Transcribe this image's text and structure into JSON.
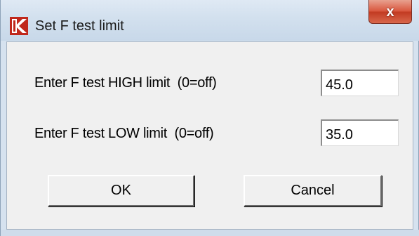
{
  "window": {
    "title": "Set F test limit",
    "close_label": "x",
    "icon": "app-logo-icon"
  },
  "form": {
    "high_label": "Enter F test HIGH limit  (0=off)",
    "high_value": "45.0",
    "low_label": "Enter F test LOW limit  (0=off)",
    "low_value": "35.0"
  },
  "buttons": {
    "ok_label": "OK",
    "cancel_label": "Cancel"
  },
  "colors": {
    "title_bar": "#d2e0ee",
    "close_button": "#c94a32",
    "client_area": "#f0f0f0",
    "logo": "#c0281c"
  }
}
